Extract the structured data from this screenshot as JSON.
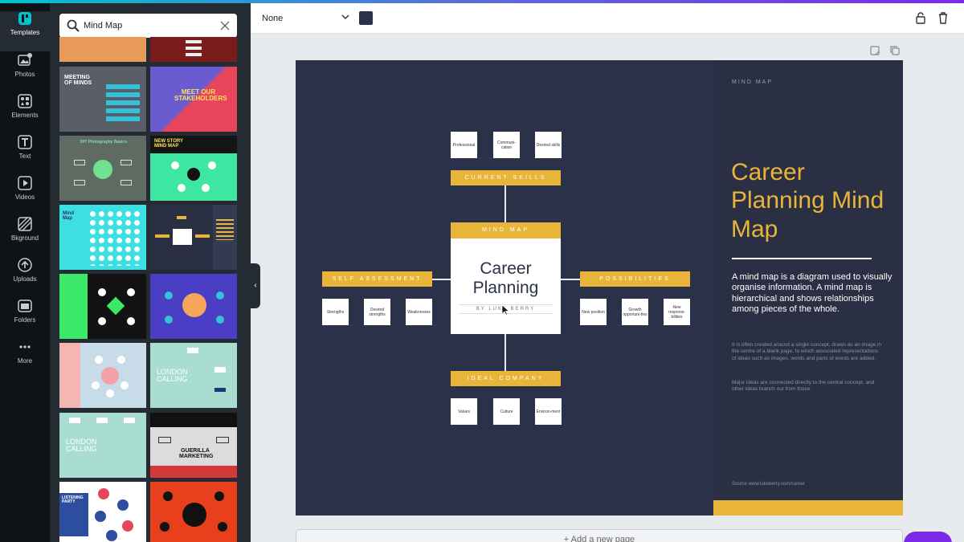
{
  "rail": {
    "items": [
      {
        "label": "Templates",
        "icon": "templates-icon",
        "active": true
      },
      {
        "label": "Photos",
        "icon": "photos-icon"
      },
      {
        "label": "Elements",
        "icon": "elements-icon"
      },
      {
        "label": "Text",
        "icon": "text-icon"
      },
      {
        "label": "Videos",
        "icon": "videos-icon"
      },
      {
        "label": "Bkground",
        "icon": "background-icon"
      },
      {
        "label": "Uploads",
        "icon": "uploads-icon"
      },
      {
        "label": "Folders",
        "icon": "folders-icon"
      },
      {
        "label": "More",
        "icon": "more-icon"
      }
    ]
  },
  "search": {
    "value": "Mind Map"
  },
  "templates": [
    {
      "title": ""
    },
    {
      "title": ""
    },
    {
      "title": "MEETING OF MINDS"
    },
    {
      "title": "MEET OUR STAKEHOLDERS"
    },
    {
      "title": "DIY Photography Basics"
    },
    {
      "title": "NEW STORY MIND MAP"
    },
    {
      "title": "Mind Map"
    },
    {
      "title": ""
    },
    {
      "title": ""
    },
    {
      "title": ""
    },
    {
      "title": ""
    },
    {
      "title": "LONDON CALLING"
    },
    {
      "title": "LONDON CALLING"
    },
    {
      "title": "GUERILLA MARKETING"
    },
    {
      "title": "LISTENING PARTY"
    },
    {
      "title": ""
    }
  ],
  "toolbar": {
    "font_value": "None",
    "text_color": "#2b3148"
  },
  "design": {
    "background": "#2b3148",
    "accent": "#e8b53a",
    "top_nodes": [
      "Professional",
      "Communi-cation",
      "Desired skills"
    ],
    "top_tag": "CURRENT SKILLS",
    "center_tag": "MIND MAP",
    "center_title_line1": "Career",
    "center_title_line2": "Planning",
    "center_byline": "BY LUKE BERRY",
    "left_tag": "SELF ASSESSMENT",
    "left_nodes": [
      "Strengths",
      "Desired strengths",
      "Weaknesses"
    ],
    "right_tag": "POSSIBILITIES",
    "right_nodes": [
      "New position",
      "Growth opportuni-ties",
      "New responsi-bilities"
    ],
    "bottom_tag": "IDEAL COMPANY",
    "bottom_nodes": [
      "Values",
      "Culture",
      "Environ-ment"
    ],
    "panel": {
      "eyebrow": "MIND MAP",
      "title": "Career Planning Mind Map",
      "lead": "A mind map is a diagram used to visually organise information. A mind map is hierarchical and shows relationships among pieces of the whole.",
      "body1": "It is often created around a single concept, drawn as an image in the centre of a blank page, to which associated representations of ideas such as images, words and parts of words are added.",
      "body2": "Major ideas are connected directly to the central concept, and other ideas branch out from those.",
      "source": "Source www.lukeberry.com/career"
    }
  },
  "footer": {
    "add_page": "+ Add a new page"
  }
}
